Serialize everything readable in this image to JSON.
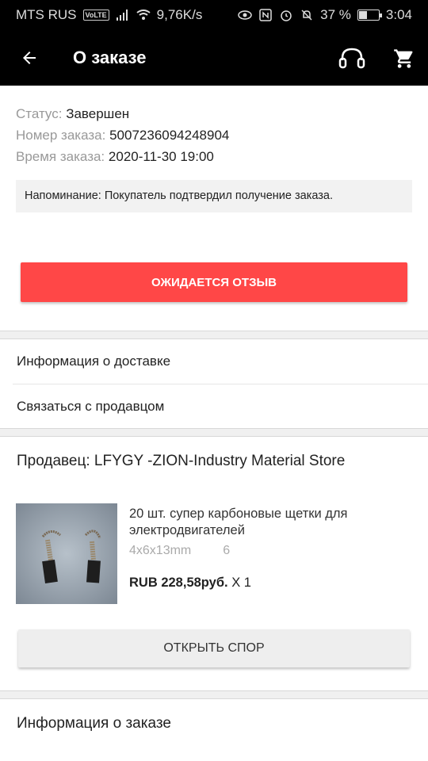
{
  "status_bar": {
    "carrier": "MTS RUS",
    "volte": "VoLTE",
    "speed": "9,76K/s",
    "battery": "37 %",
    "time": "3:04",
    "icons": [
      "signal-icon",
      "wifi-icon",
      "eye-icon",
      "nfc-icon",
      "alarm-icon",
      "mute-icon",
      "battery-icon"
    ]
  },
  "appbar": {
    "title": "О заказе",
    "back_icon": "arrow-left-icon",
    "support_icon": "headset-icon",
    "cart_icon": "cart-icon"
  },
  "order": {
    "status_label": "Статус:",
    "status_value": "Завершен",
    "number_label": "Номер заказа:",
    "number_value": "5007236094248904",
    "time_label": "Время заказа:",
    "time_value": "2020-11-30 19:00",
    "reminder": "Напоминание: Покупатель подтвердил получение заказа.",
    "review_button": "ОЖИДАЕТСЯ ОТЗЫВ"
  },
  "menu": {
    "delivery": "Информация о доставке",
    "contact": "Связаться с продавцом"
  },
  "seller": {
    "label": "Продавец: LFYGY -ZION-Industry Material Store"
  },
  "product": {
    "title": "20 шт. супер карбоновые щетки для электродвигателей",
    "variant": "4x6x13mm",
    "variant_qty": "6",
    "price": "RUB 228,58руб.",
    "quantity": "X 1"
  },
  "dispute_button": "ОТКРЫТЬ СПОР",
  "order_info": "Информация о заказе",
  "colors": {
    "accent": "#ff4747",
    "appbar": "#000000"
  }
}
